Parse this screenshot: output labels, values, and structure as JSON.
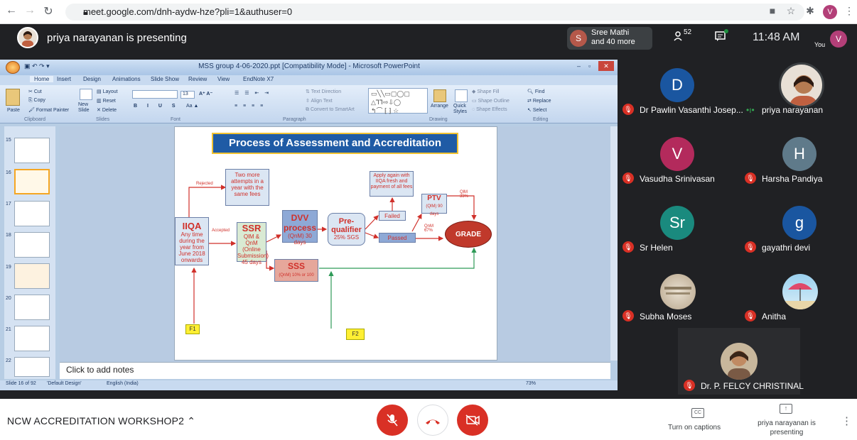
{
  "browser": {
    "url": "meet.google.com/dnh-aydw-hze?pli=1&authuser=0",
    "profile_initial": "V"
  },
  "meet": {
    "presenter_banner": "priya narayanan is presenting",
    "participant_chip_initial": "S",
    "participant_chip_line1": "Sree Mathi",
    "participant_chip_line2": "and 40 more",
    "people_count": "52",
    "time": "11:48 AM",
    "self_label": "You",
    "self_initial": "V"
  },
  "powerpoint": {
    "window_title": "MSS group 4-06-2020.ppt [Compatibility Mode] - Microsoft PowerPoint",
    "tabs": [
      "Home",
      "Insert",
      "Design",
      "Animations",
      "Slide Show",
      "Review",
      "View",
      "EndNote X7"
    ],
    "clipboard": {
      "cut": "Cut",
      "copy": "Copy",
      "paste": "Paste",
      "format_painter": "Format Painter",
      "group": "Clipboard"
    },
    "slides_group": {
      "new_slide": "New Slide",
      "layout": "Layout",
      "reset": "Reset",
      "delete": "Delete",
      "group": "Slides"
    },
    "font_group": {
      "size": "13",
      "group": "Font"
    },
    "paragraph_group": {
      "text_direction": "Text Direction",
      "align_text": "Align Text",
      "convert": "Convert to SmartArt",
      "group": "Paragraph"
    },
    "drawing_group": {
      "arrange": "Arrange",
      "quick_styles": "Quick Styles",
      "shape_fill": "Shape Fill",
      "shape_outline": "Shape Outline",
      "shape_effects": "Shape Effects",
      "group": "Drawing"
    },
    "editing_group": {
      "find": "Find",
      "replace": "Replace",
      "select": "Select",
      "group": "Editing"
    },
    "thumb_numbers": [
      "15",
      "16",
      "17",
      "18",
      "19",
      "20",
      "21",
      "22"
    ],
    "notes_placeholder": "Click to add notes",
    "status": {
      "slide": "Slide 16 of 92",
      "theme": "'Default Design'",
      "language": "English (India)",
      "zoom": "73%"
    }
  },
  "slide": {
    "title": "Process of Assessment and Accreditation",
    "iiqa_title": "IIQA",
    "iiqa_text": "Any time during the year from June 2018 onwards",
    "rejected_label": "Rejected",
    "rejected_box": "Two more attempts in a year with the same fees",
    "accepted_label": "Accepted",
    "ssr_title": "SSR",
    "ssr_text": "QlM & QnM (Online Submission) 45 days",
    "dvv_title": "DVV process",
    "dvv_text": "(QnM) 30 days",
    "pre_title": "Pre-qualifier",
    "pre_text": "25% SGS",
    "failed": "Failed",
    "passed": "Passed",
    "apply_again": "Apply again with IIQA fresh and payment of all fees",
    "ptv_title": "PTV",
    "ptv_text": "(QlM) 90 days",
    "qlm": "QlM 33%",
    "qnm": "QnM 67%",
    "grade": "GRADE",
    "sss_title": "SSS",
    "sss_text": "(QnM) 10% or 100",
    "f1": "F1",
    "f2": "F2"
  },
  "participants": [
    {
      "name": "Dr Pawlin Vasanthi Josep...",
      "initial": "D",
      "color": "#1a56a0",
      "muted": true
    },
    {
      "name": "priya narayanan",
      "initial": "",
      "color": "#e8e0d6",
      "muted": false
    },
    {
      "name": "Vasudha Srinivasan",
      "initial": "V",
      "color": "#b32a5c",
      "muted": true
    },
    {
      "name": "Harsha Pandiya",
      "initial": "H",
      "color": "#5f7a8a",
      "muted": true
    },
    {
      "name": "Sr Helen",
      "initial": "Sr",
      "color": "#1a8a7e",
      "muted": true
    },
    {
      "name": "gayathri devi",
      "initial": "g",
      "color": "#1a56a0",
      "muted": true
    },
    {
      "name": "Subha Moses",
      "initial": "",
      "color": "#c9b9a4",
      "muted": true
    },
    {
      "name": "Anitha",
      "initial": "",
      "color": "#6aa7c7",
      "muted": true
    },
    {
      "name": "Dr. P. FELCY CHRISTINAL",
      "initial": "",
      "color": "#7a5a45",
      "muted": true
    }
  ],
  "bottom_bar": {
    "meeting_name": "NCW ACCREDITATION WORKSHOP2",
    "captions_label": "Turn on captions",
    "presenting_label": "priya narayanan is presenting"
  },
  "colors": {
    "danger": "#d93025",
    "meet_bg": "#202124"
  }
}
